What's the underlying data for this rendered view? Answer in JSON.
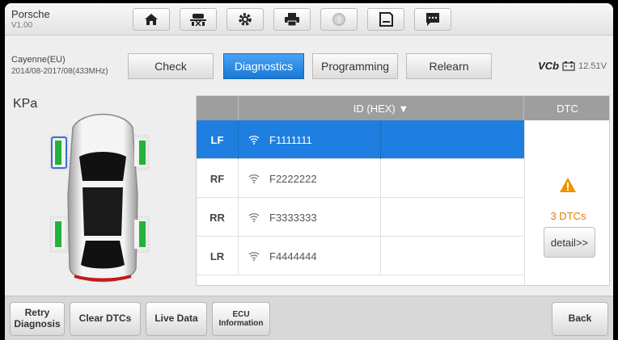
{
  "app": {
    "title": "Porsche",
    "version": "V1.00"
  },
  "toolbar": {
    "icons": [
      "home-icon",
      "vehicle-lift-icon",
      "gear-icon",
      "printer-icon",
      "help-icon",
      "save-icon",
      "message-icon"
    ]
  },
  "vehicle": {
    "name": "Cayenne(EU)",
    "range": "2014/08-2017/08(433MHz)"
  },
  "tabs": [
    {
      "label": "Check"
    },
    {
      "label": "Diagnostics",
      "active": true
    },
    {
      "label": "Programming"
    },
    {
      "label": "Relearn"
    }
  ],
  "vci": {
    "logo": "VCb",
    "voltage": "12.51V"
  },
  "unit_label": "KPa",
  "table": {
    "headers": {
      "id": "ID (HEX) ▼",
      "dtc": "DTC"
    },
    "rows": [
      {
        "pos": "LF",
        "id": "F1111111",
        "selected": true
      },
      {
        "pos": "RF",
        "id": "F2222222"
      },
      {
        "pos": "RR",
        "id": "F3333333"
      },
      {
        "pos": "LR",
        "id": "F4444444"
      }
    ],
    "dtc_summary": "3 DTCs",
    "detail_label": "detail>>"
  },
  "footer": {
    "retry": "Retry\nDiagnosis",
    "clear": "Clear DTCs",
    "live": "Live Data",
    "ecu": "ECU\nInformation",
    "back": "Back"
  },
  "colors": {
    "accent": "#1e7fe0",
    "warning": "#f29200",
    "sensor_ok": "#22b33a"
  }
}
